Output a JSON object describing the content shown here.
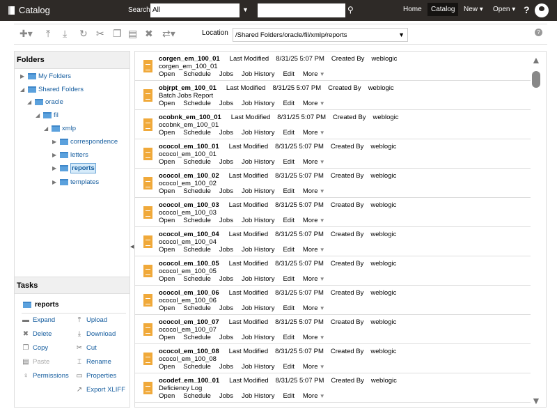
{
  "header": {
    "title": "Catalog",
    "search_label": "Search",
    "search_scope": "All",
    "search_value": "",
    "nav": [
      "Home",
      "Catalog",
      "New",
      "Open"
    ],
    "help": "?"
  },
  "toolbar": {
    "location_label": "Location",
    "location_value": "/Shared Folders/oracle/fil/xmlp/reports"
  },
  "folders": {
    "title": "Folders",
    "items": [
      "My Folders",
      "Shared Folders",
      "oracle",
      "fil",
      "xmlp",
      "correspondence",
      "letters",
      "reports",
      "templates"
    ]
  },
  "tasks": {
    "title": "Tasks",
    "current": "reports",
    "left": [
      "Expand",
      "Delete",
      "Copy",
      "Paste",
      "Permissions"
    ],
    "right": [
      "Upload",
      "Download",
      "Cut",
      "Rename",
      "Properties",
      "Export XLIFF"
    ]
  },
  "labels": {
    "modified": "Last Modified",
    "created": "Created By",
    "actions": [
      "Open",
      "Schedule",
      "Jobs",
      "Job History",
      "Edit",
      "More"
    ]
  },
  "items": [
    {
      "name": "corgen_em_100_01",
      "desc": "corgen_em_100_01",
      "modified": "8/31/25 5:07 PM",
      "by": "weblogic"
    },
    {
      "name": "objrpt_em_100_01",
      "desc": "Batch Jobs Report",
      "modified": "8/31/25 5:07 PM",
      "by": "weblogic"
    },
    {
      "name": "ocobnk_em_100_01",
      "desc": "ocobnk_em_100_01",
      "modified": "8/31/25 5:07 PM",
      "by": "weblogic"
    },
    {
      "name": "ococol_em_100_01",
      "desc": "ococol_em_100_01",
      "modified": "8/31/25 5:07 PM",
      "by": "weblogic"
    },
    {
      "name": "ococol_em_100_02",
      "desc": "ococol_em_100_02",
      "modified": "8/31/25 5:07 PM",
      "by": "weblogic"
    },
    {
      "name": "ococol_em_100_03",
      "desc": "ococol_em_100_03",
      "modified": "8/31/25 5:07 PM",
      "by": "weblogic"
    },
    {
      "name": "ococol_em_100_04",
      "desc": "ococol_em_100_04",
      "modified": "8/31/25 5:07 PM",
      "by": "weblogic"
    },
    {
      "name": "ococol_em_100_05",
      "desc": "ococol_em_100_05",
      "modified": "8/31/25 5:07 PM",
      "by": "weblogic"
    },
    {
      "name": "ococol_em_100_06",
      "desc": "ococol_em_100_06",
      "modified": "8/31/25 5:07 PM",
      "by": "weblogic"
    },
    {
      "name": "ococol_em_100_07",
      "desc": "ococol_em_100_07",
      "modified": "8/31/25 5:07 PM",
      "by": "weblogic"
    },
    {
      "name": "ococol_em_100_08",
      "desc": "ococol_em_100_08",
      "modified": "8/31/25 5:07 PM",
      "by": "weblogic"
    },
    {
      "name": "ocodef_em_100_01",
      "desc": "Deficiency Log",
      "modified": "8/31/25 5:07 PM",
      "by": "weblogic"
    }
  ]
}
